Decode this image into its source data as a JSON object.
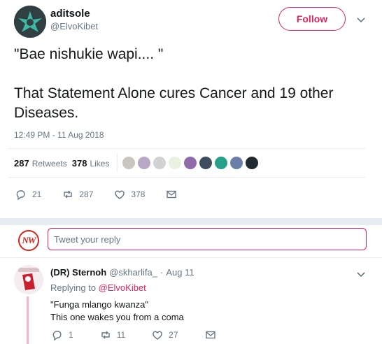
{
  "tweet": {
    "author_name": "aditsole",
    "author_handle": "@ElvoKibet",
    "follow_label": "Follow",
    "text": "\"Bae nishukie wapi.... \"\n\nThat Statement Alone cures Cancer and 19 other Diseases.",
    "timestamp": "12:49 PM - 11 Aug 2018",
    "retweets_count": "287",
    "retweets_label": "Retweets",
    "likes_count": "378",
    "likes_label": "Likes",
    "actions": {
      "replies": "21",
      "retweets": "287",
      "likes": "378"
    }
  },
  "liker_avatar_colors": [
    "#c9c6c0",
    "#b9a8c4",
    "#d0d2d4",
    "#e9f1e2",
    "#8f6ca9",
    "#3e4d5e",
    "#27a08a",
    "#6a7fa8",
    "#222a31"
  ],
  "reply_box": {
    "logo_text": "NW",
    "placeholder": "Tweet your reply"
  },
  "reply": {
    "name": "(DR) Sternoh",
    "handle": "@skharlifa_",
    "dot": "·",
    "date": "Aug 11",
    "replying_prefix": "Replying to",
    "replying_to": "@ElvoKibet",
    "text": "\"Funga mlango kwanza\"\nThis one wakes you from a coma",
    "actions": {
      "replies": "1",
      "retweets": "11",
      "likes": "27"
    }
  },
  "colors": {
    "accent": "#e0245e",
    "secondary_text": "#657786",
    "divider": "#e6ecf0"
  },
  "icons": [
    "caret-down-icon",
    "reply-icon",
    "retweet-icon",
    "heart-icon",
    "message-icon"
  ]
}
